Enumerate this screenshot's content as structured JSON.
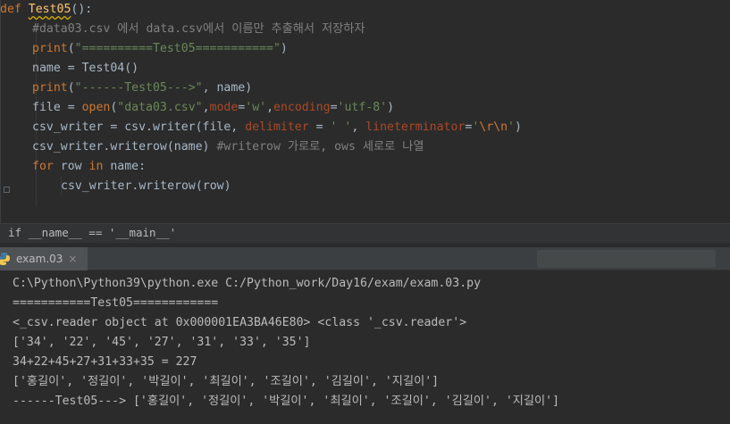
{
  "editor": {
    "lines": [
      {
        "segments": [
          {
            "t": "def ",
            "c": "kw"
          },
          {
            "t": "Test05",
            "c": "fn"
          },
          {
            "t": "():",
            "c": ""
          }
        ]
      },
      {
        "segments": [
          {
            "t": "#data03.csv 에서 data.csv에서 이름만 추출해서 저장하자",
            "c": "cmt"
          }
        ]
      },
      {
        "segments": [
          {
            "t": "print",
            "c": "kw"
          },
          {
            "t": "(",
            "c": ""
          },
          {
            "t": "\"==========Test05===========\"",
            "c": "str"
          },
          {
            "t": ")",
            "c": ""
          }
        ]
      },
      {
        "segments": [
          {
            "t": "name = Test04()",
            "c": ""
          }
        ]
      },
      {
        "segments": [
          {
            "t": "print",
            "c": "kw"
          },
          {
            "t": "(",
            "c": ""
          },
          {
            "t": "\"------Test05--->\"",
            "c": "str"
          },
          {
            "t": ", name)",
            "c": ""
          }
        ]
      },
      {
        "segments": [
          {
            "t": "file = ",
            "c": ""
          },
          {
            "t": "open",
            "c": "kw"
          },
          {
            "t": "(",
            "c": ""
          },
          {
            "t": "\"data03.csv\"",
            "c": "str"
          },
          {
            "t": ",",
            "c": ""
          },
          {
            "t": "mode",
            "c": "prm"
          },
          {
            "t": "=",
            "c": ""
          },
          {
            "t": "'w'",
            "c": "str"
          },
          {
            "t": ",",
            "c": ""
          },
          {
            "t": "encoding",
            "c": "prm"
          },
          {
            "t": "=",
            "c": ""
          },
          {
            "t": "'utf-8'",
            "c": "str"
          },
          {
            "t": ")",
            "c": ""
          }
        ]
      },
      {
        "segments": [
          {
            "t": "csv_writer = csv.writer(file, ",
            "c": ""
          },
          {
            "t": "delimiter",
            "c": "prm"
          },
          {
            "t": " = ",
            "c": ""
          },
          {
            "t": "' '",
            "c": "str"
          },
          {
            "t": ", ",
            "c": ""
          },
          {
            "t": "lineterminator",
            "c": "prm"
          },
          {
            "t": "=",
            "c": ""
          },
          {
            "t": "'",
            "c": "str"
          },
          {
            "t": "\\r\\n",
            "c": "esc"
          },
          {
            "t": "'",
            "c": "str"
          },
          {
            "t": ")",
            "c": ""
          }
        ]
      },
      {
        "segments": [
          {
            "t": "csv_writer.writerow(name) ",
            "c": ""
          },
          {
            "t": "#writerow 가로로, ows 세로로 나열",
            "c": "cmt"
          }
        ]
      },
      {
        "segments": [
          {
            "t": "for ",
            "c": "kw"
          },
          {
            "t": "row ",
            "c": ""
          },
          {
            "t": "in ",
            "c": "kw"
          },
          {
            "t": "name:",
            "c": ""
          }
        ]
      },
      {
        "segments": [
          {
            "t": "csv_writer.writerow(row)",
            "c": ""
          }
        ]
      }
    ]
  },
  "breadcrumb": "if __name__ == '__main__'",
  "run_tab": {
    "label": "exam.03",
    "close": "×"
  },
  "console": {
    "lines": [
      "C:\\Python\\Python39\\python.exe C:/Python_work/Day16/exam/exam.03.py",
      "===========Test05============",
      "<_csv.reader object at 0x000001EA3BA46E80> <class '_csv.reader'>",
      "['34', '22', '45', '27', '31', '33', '35']",
      "34+22+45+27+31+33+35 = 227",
      "['홍길이', '정길이', '박길이', '최길이', '조길이', '김길이', '지길이']",
      "------Test05---> ['홍길이', '정길이', '박길이', '최길이', '조길이', '김길이', '지길이']"
    ]
  }
}
